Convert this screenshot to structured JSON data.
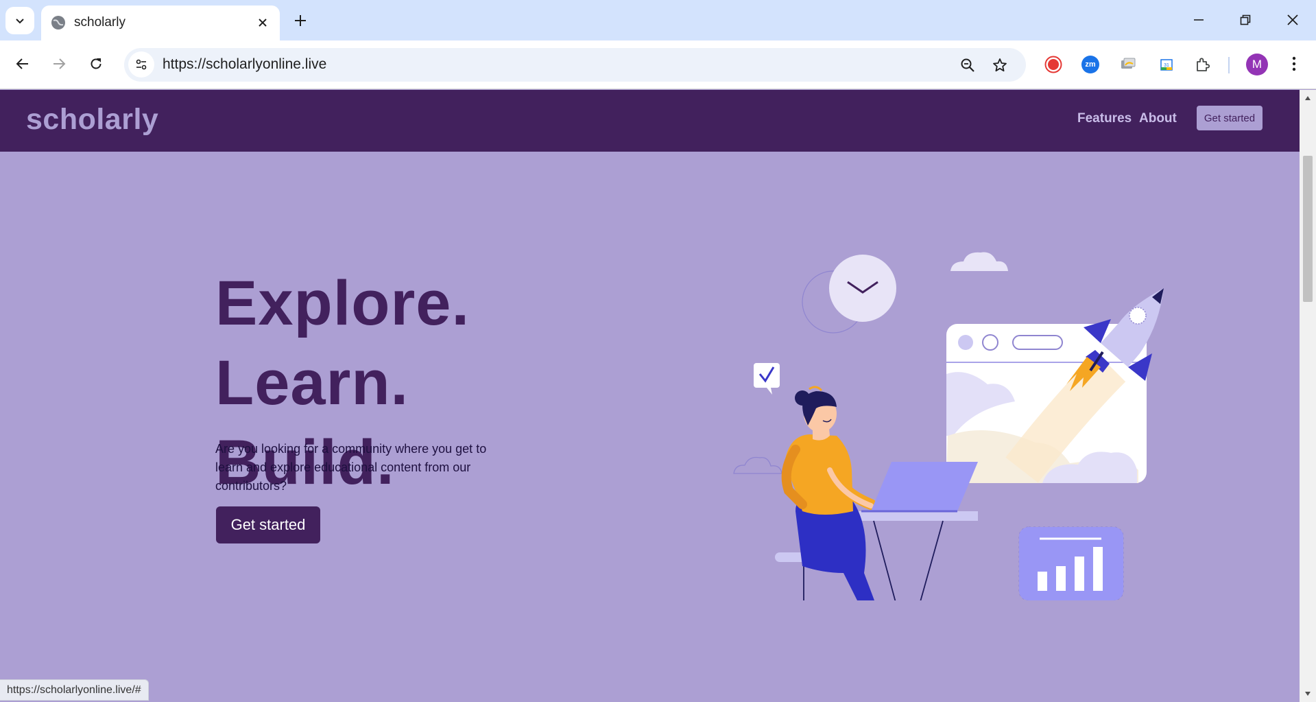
{
  "browser": {
    "tab_title": "scholarly",
    "url": "https://scholarlyonline.live",
    "profile_initial": "M",
    "status_url": "https://scholarlyonline.live/#",
    "extensions": [
      {
        "name": "record-extension-icon",
        "color": "#e53935"
      },
      {
        "name": "zoom-extension-icon",
        "label": "zm",
        "color": "#1a73e8"
      },
      {
        "name": "screen-share-extension-icon",
        "color": "#9aa0a6"
      },
      {
        "name": "calendar-extension-icon",
        "color": "#34a853"
      },
      {
        "name": "extensions-puzzle-icon",
        "color": "#444746"
      }
    ]
  },
  "site": {
    "logo": "scholarly",
    "nav": {
      "features": "Features",
      "about": "About",
      "cta": "Get started"
    },
    "hero": {
      "line1": "Explore.",
      "line2": "Learn.",
      "line3": "Build.",
      "lead": "Are you looking for a community where you get to learn and explore educational content from our contributors?",
      "cta": "Get started"
    },
    "colors": {
      "brand_dark": "#42215d",
      "brand_light": "#ac9fd3"
    }
  }
}
